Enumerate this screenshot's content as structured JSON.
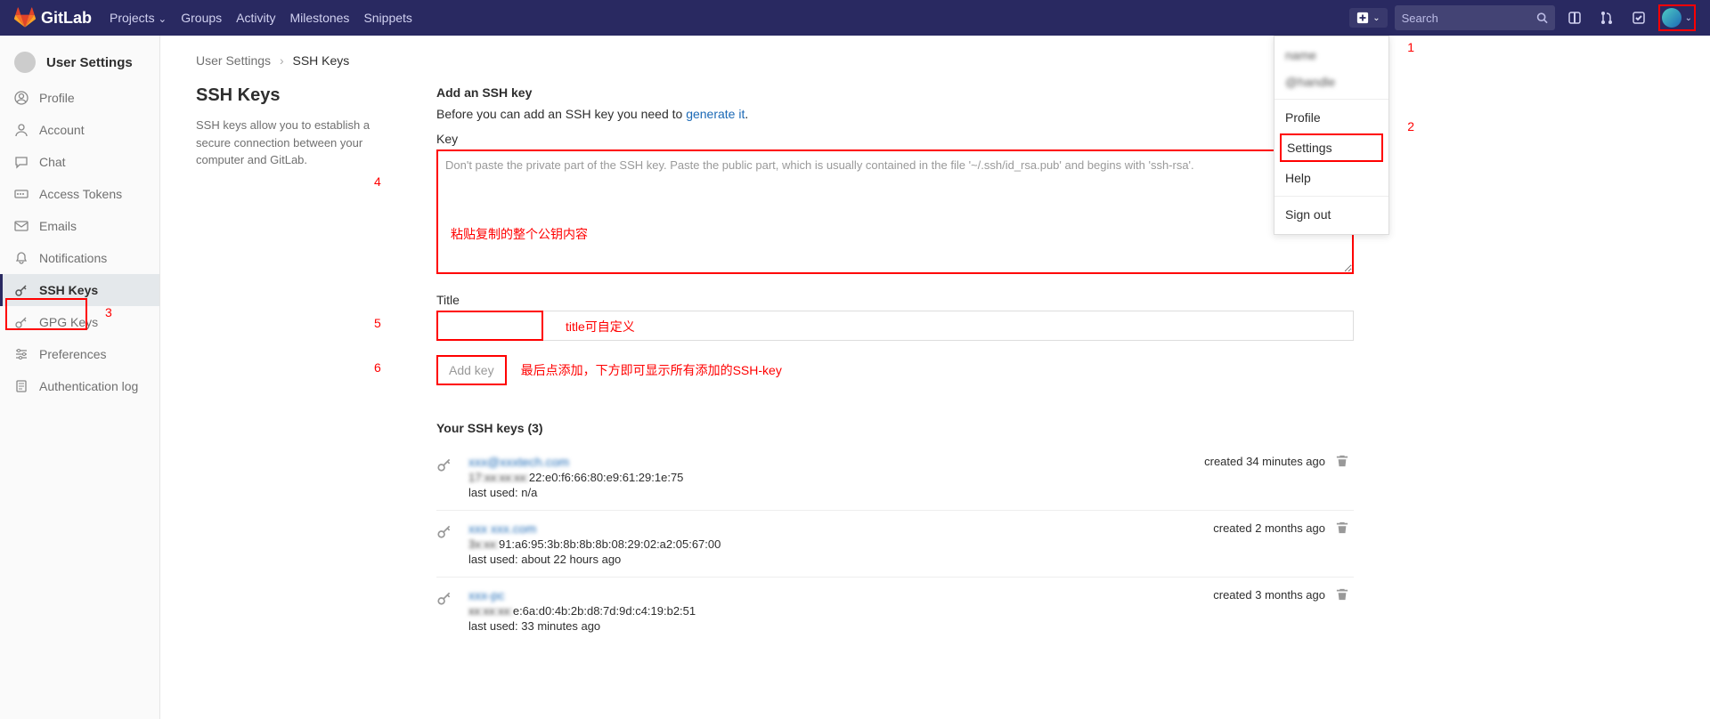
{
  "brand": "GitLab",
  "nav": {
    "projects": "Projects",
    "groups": "Groups",
    "activity": "Activity",
    "milestones": "Milestones",
    "snippets": "Snippets"
  },
  "search": {
    "placeholder": "Search"
  },
  "sidebar": {
    "header": "User Settings",
    "items": [
      {
        "label": "Profile"
      },
      {
        "label": "Account"
      },
      {
        "label": "Chat"
      },
      {
        "label": "Access Tokens"
      },
      {
        "label": "Emails"
      },
      {
        "label": "Notifications"
      },
      {
        "label": "SSH Keys"
      },
      {
        "label": "GPG Keys"
      },
      {
        "label": "Preferences"
      },
      {
        "label": "Authentication log"
      }
    ]
  },
  "breadcrumb": {
    "a": "User Settings",
    "b": "SSH Keys"
  },
  "page": {
    "title": "SSH Keys",
    "desc": "SSH keys allow you to establish a secure connection between your computer and GitLab.",
    "add_title": "Add an SSH key",
    "before_text": "Before you can add an SSH key you need to ",
    "generate": "generate it",
    "key_label": "Key",
    "key_placeholder": "Don't paste the private part of the SSH key. Paste the public part, which is usually contained in the file '~/.ssh/id_rsa.pub' and begins with 'ssh-rsa'.",
    "title_label": "Title",
    "addkey": "Add key",
    "your_keys": "Your SSH keys (3)"
  },
  "keys": [
    {
      "name": "xxx@xxxtech.com",
      "fp_a": "17:",
      "fp_b": "22:e0:f6:66:80:e9:61:29:1e:75",
      "last": "last used: n/a",
      "created": "created 34 minutes ago"
    },
    {
      "name": "xxx xxx.com",
      "fp_a": "3",
      "fp_b": "91:a6:95:3b:8b:8b:8b:08:29:02:a2:05:67:00",
      "last": "last used: about 22 hours ago",
      "created": "created 2 months ago"
    },
    {
      "name": "xxx-pc",
      "fp_a": "",
      "fp_b": "e:6a:d0:4b:2b:d8:7d:9d:c4:19:b2:51",
      "last": "last used: 33 minutes ago",
      "created": "created 3 months ago"
    }
  ],
  "user_menu": {
    "head1": "name",
    "head2": "@handle",
    "profile": "Profile",
    "settings": "Settings",
    "help": "Help",
    "signout": "Sign out"
  },
  "anno": {
    "n1": "1",
    "n2": "2",
    "n3": "3",
    "n4": "4",
    "n5": "5",
    "n6": "6",
    "paste": "粘贴复制的整个公钥内容",
    "title_hint": "title可自定义",
    "add_hint": "最后点添加，下方即可显示所有添加的SSH-key"
  }
}
